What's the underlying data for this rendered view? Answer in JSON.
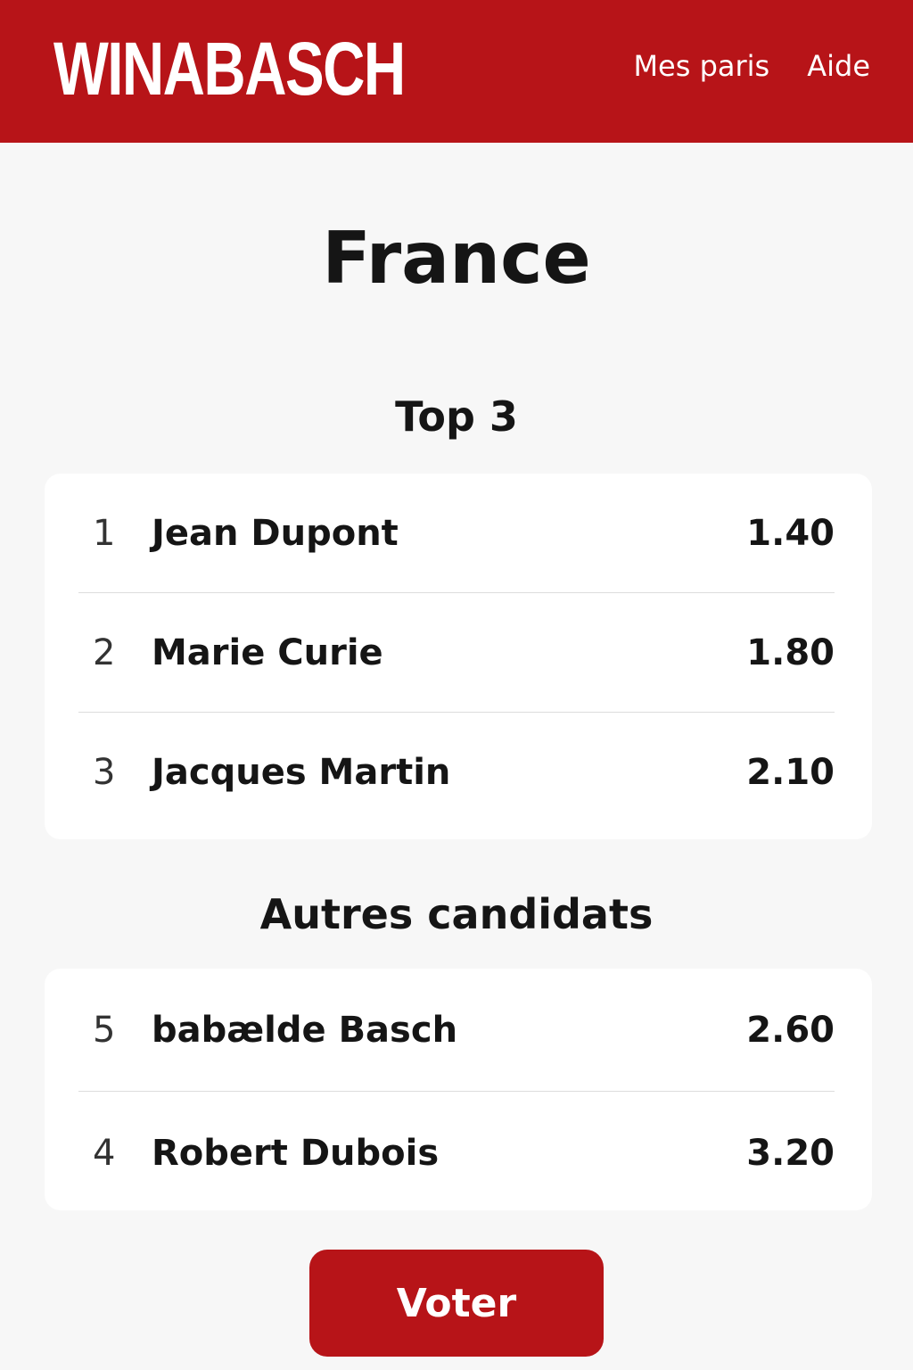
{
  "header": {
    "logo": "WINABASCH",
    "nav": [
      "Mes paris",
      "Aide"
    ]
  },
  "page": {
    "title": "France"
  },
  "top3": {
    "heading": "Top 3",
    "rows": [
      {
        "rank": "1",
        "name": "Jean Dupont",
        "odds": "1.40"
      },
      {
        "rank": "2",
        "name": "Marie Curie",
        "odds": "1.80"
      },
      {
        "rank": "3",
        "name": "Jacques Martin",
        "odds": "2.10"
      }
    ]
  },
  "others": {
    "heading": "Autres candidats",
    "rows": [
      {
        "rank": "5",
        "name": "babælde Basch",
        "odds": "2.60"
      },
      {
        "rank": "4",
        "name": "Robert Dubois",
        "odds": "3.20"
      }
    ]
  },
  "actions": {
    "vote_label": "Voter"
  },
  "colors": {
    "brand": "#b71418",
    "background": "#f7f7f7",
    "card": "#ffffff"
  }
}
